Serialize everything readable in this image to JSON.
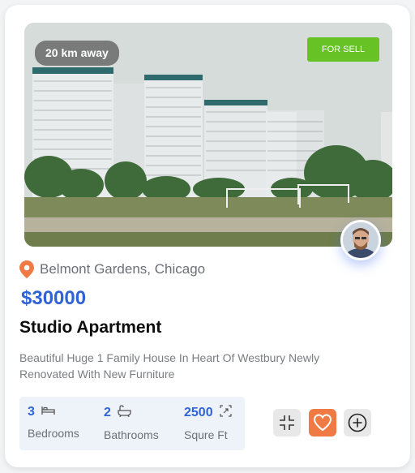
{
  "listing": {
    "distance": "20 km away",
    "status": "FOR SELL",
    "location": "Belmont Gardens, Chicago",
    "price": "$30000",
    "title": "Studio Apartment",
    "description": "Beautiful Huge 1 Family House In Heart Of Westbury Newly Renovated With New Furniture"
  },
  "specs": [
    {
      "value": "3",
      "label": "Bedrooms",
      "icon": "bed-icon"
    },
    {
      "value": "2",
      "label": "Bathrooms",
      "icon": "bathtub-icon"
    },
    {
      "value": "2500",
      "label": "Squre Ft",
      "icon": "area-icon"
    }
  ],
  "actions": [
    {
      "icon": "compare-icon"
    },
    {
      "icon": "heart-icon"
    },
    {
      "icon": "plus-circle-icon"
    }
  ],
  "colors": {
    "accent_blue": "#2f63d6",
    "status_green": "#67c325",
    "favorite_orange": "#f07a44",
    "pin_orange": "#f07a44"
  }
}
